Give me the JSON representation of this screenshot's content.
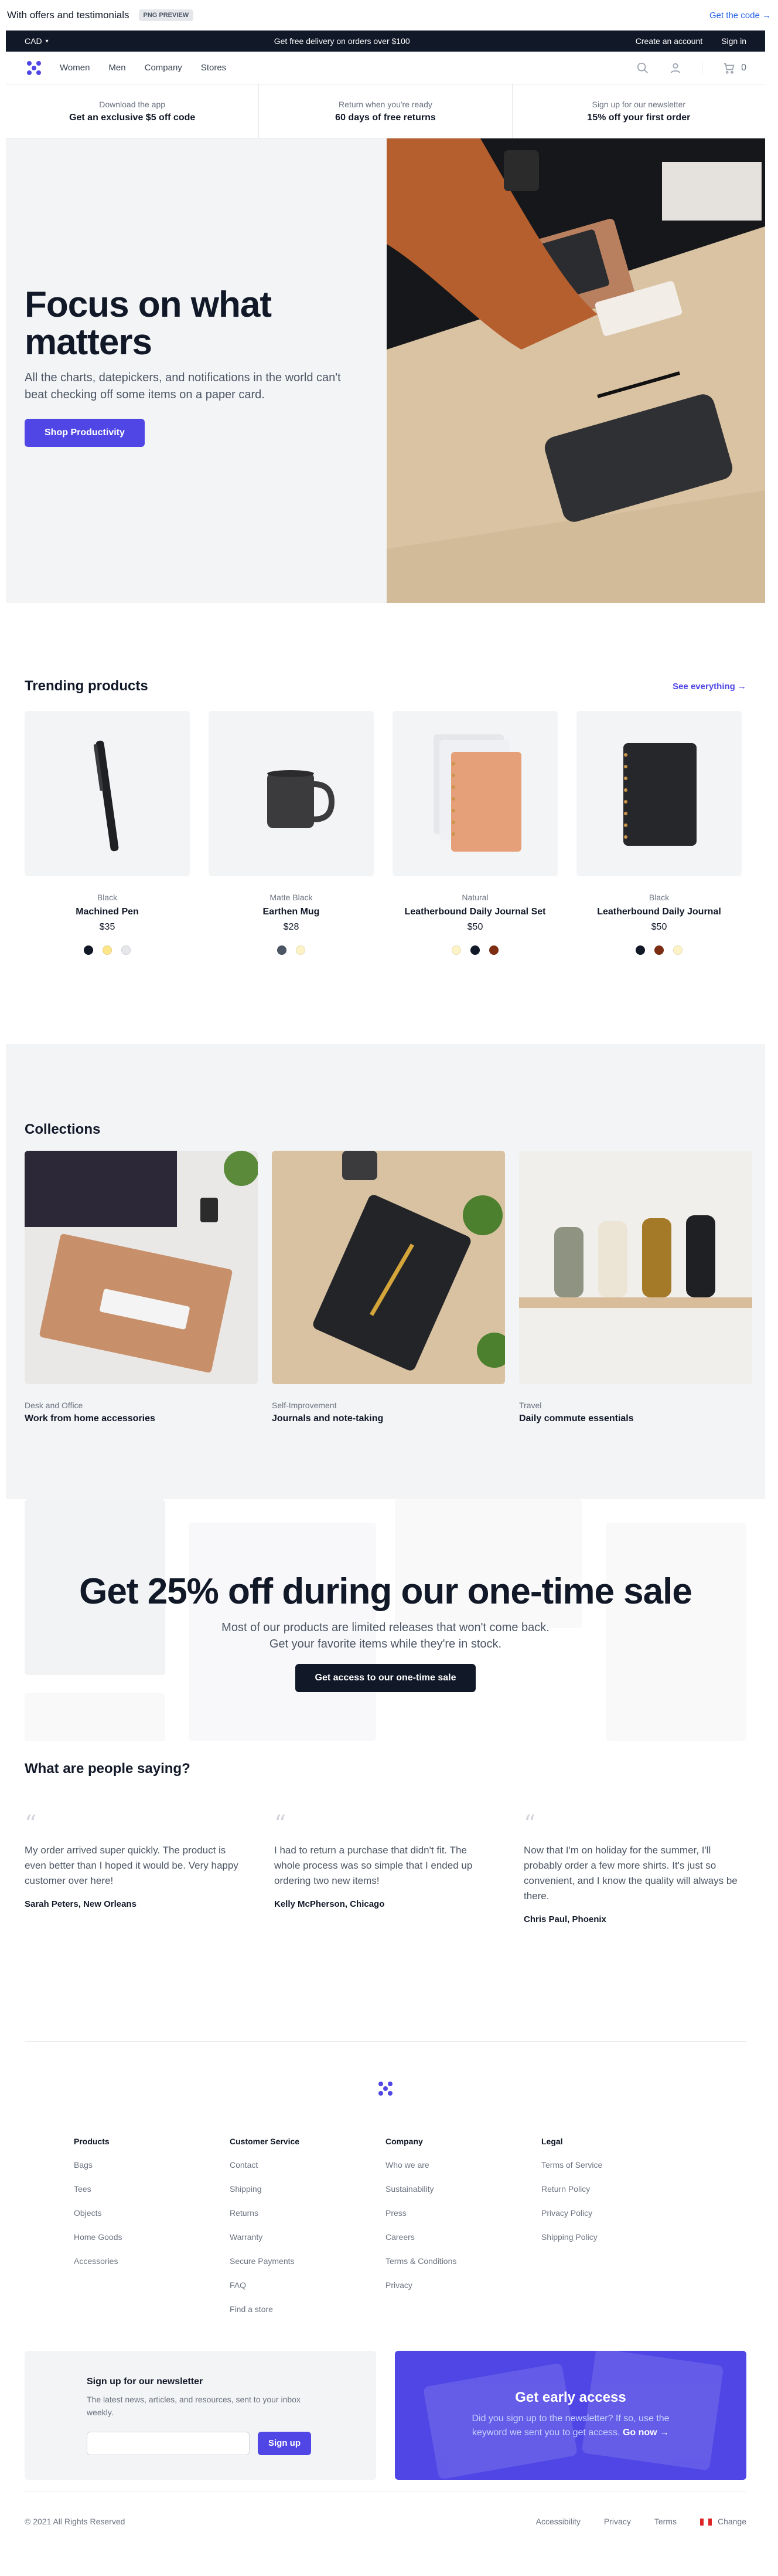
{
  "preview_bar": {
    "title": "With offers and testimonials",
    "badge": "PNG PREVIEW",
    "link": "Get the code →"
  },
  "topbar": {
    "currency": "CAD",
    "announcement": "Get free delivery on orders over $100",
    "create_account": "Create an account",
    "sign_in": "Sign in"
  },
  "nav": {
    "links": [
      "Women",
      "Men",
      "Company",
      "Stores"
    ],
    "cart_count": "0"
  },
  "perks": [
    {
      "small": "Download the app",
      "bold": "Get an exclusive $5 off code"
    },
    {
      "small": "Return when you're ready",
      "bold": "60 days of free returns"
    },
    {
      "small": "Sign up for our newsletter",
      "bold": "15% off your first order"
    }
  ],
  "hero": {
    "title": "Focus on what matters",
    "body": "All the charts, datepickers, and notifications in the world can't beat checking off some items on a paper card.",
    "cta": "Shop Productivity"
  },
  "trending": {
    "title": "Trending products",
    "see_all": "See everything →",
    "products": [
      {
        "color": "Black",
        "name": "Machined Pen",
        "price": "$35",
        "swatches": [
          "#111827",
          "#fde68a",
          "#e5e7eb"
        ]
      },
      {
        "color": "Matte Black",
        "name": "Earthen Mug",
        "price": "$28",
        "swatches": [
          "#4b5563",
          "#fef3c7"
        ]
      },
      {
        "color": "Natural",
        "name": "Leatherbound Daily Journal Set",
        "price": "$50",
        "swatches": [
          "#fef3c7",
          "#111827",
          "#7c2d12"
        ]
      },
      {
        "color": "Black",
        "name": "Leatherbound Daily Journal",
        "price": "$50",
        "swatches": [
          "#111827",
          "#7c2d12",
          "#fef3c7"
        ]
      }
    ]
  },
  "collections": {
    "title": "Collections",
    "items": [
      {
        "sub": "Desk and Office",
        "title": "Work from home accessories"
      },
      {
        "sub": "Self-Improvement",
        "title": "Journals and note-taking"
      },
      {
        "sub": "Travel",
        "title": "Daily commute essentials"
      }
    ]
  },
  "sale": {
    "title": "Get 25% off during our one-time sale",
    "body": "Most of our products are limited releases that won't come back. Get your favorite items while they're in stock.",
    "cta": "Get access to our one-time sale"
  },
  "testimonials": {
    "title": "What are people saying?",
    "items": [
      {
        "body": "My order arrived super quickly. The product is even better than I hoped it would be. Very happy customer over here!",
        "name": "Sarah Peters, New Orleans"
      },
      {
        "body": "I had to return a purchase that didn't fit. The whole process was so simple that I ended up ordering two new items!",
        "name": "Kelly McPherson, Chicago"
      },
      {
        "body": "Now that I'm on holiday for the summer, I'll probably order a few more shirts. It's just so convenient, and I know the quality will always be there.",
        "name": "Chris Paul, Phoenix"
      }
    ]
  },
  "footer": {
    "columns": [
      {
        "title": "Products",
        "items": [
          "Bags",
          "Tees",
          "Objects",
          "Home Goods",
          "Accessories"
        ]
      },
      {
        "title": "Customer Service",
        "items": [
          "Contact",
          "Shipping",
          "Returns",
          "Warranty",
          "Secure Payments",
          "FAQ",
          "Find a store"
        ]
      },
      {
        "title": "Company",
        "items": [
          "Who we are",
          "Sustainability",
          "Press",
          "Careers",
          "Terms & Conditions",
          "Privacy"
        ]
      },
      {
        "title": "Legal",
        "items": [
          "Terms of Service",
          "Return Policy",
          "Privacy Policy",
          "Shipping Policy"
        ]
      }
    ],
    "newsletter": {
      "title": "Sign up for our newsletter",
      "body": "The latest news, articles, and resources, sent to your inbox weekly.",
      "button": "Sign up"
    },
    "early": {
      "title": "Get early access",
      "body": "Did you sign up to the newsletter? If so, use the keyword we sent you to get access.",
      "link": "Go now →"
    },
    "copyright": "© 2021 All Rights Reserved",
    "bottom_links": [
      "Accessibility",
      "Privacy",
      "Terms"
    ],
    "change": "Change"
  },
  "colors": {
    "accent": "#4f46e5",
    "dark": "#111827"
  }
}
